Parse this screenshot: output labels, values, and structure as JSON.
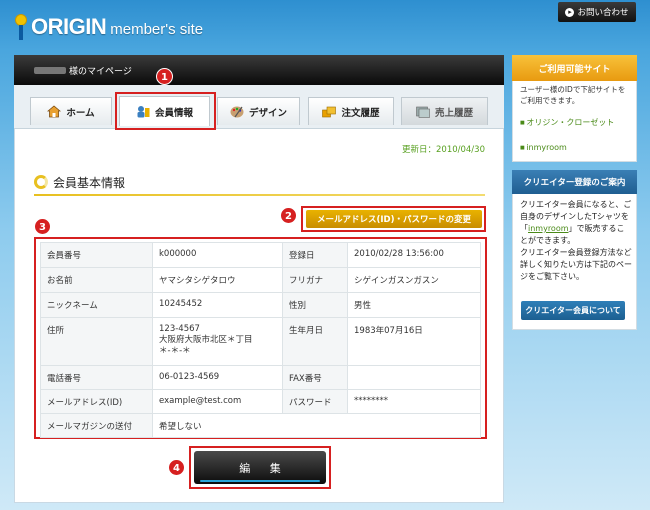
{
  "header": {
    "brand": "ORIGIN",
    "subtitle": "member's site",
    "contact_label": "お問い合わせ"
  },
  "mypage_title": "様のマイページ",
  "tabs": [
    {
      "label": "ホーム",
      "icon": "home-icon"
    },
    {
      "label": "会員情報",
      "icon": "member-icon"
    },
    {
      "label": "デザイン",
      "icon": "palette-icon"
    },
    {
      "label": "注文履歴",
      "icon": "order-history-icon"
    },
    {
      "label": "売上履歴",
      "icon": "sales-history-icon"
    }
  ],
  "updated": "更新日：2010/04/30",
  "section_title": "会員基本情報",
  "mail_password_button": "メールアドレス(ID)・パスワードの変更",
  "badges": [
    "1",
    "2",
    "3",
    "4"
  ],
  "info": {
    "member_no_label": "会員番号",
    "member_no": "k000000",
    "registered_label": "登録日",
    "registered": "2010/02/28 13:56:00",
    "name_label": "お名前",
    "name": "ヤマシタシゲタロウ",
    "furigana_label": "フリガナ",
    "furigana": "シゲインガスンガスン",
    "nickname_label": "ニックネーム",
    "nickname": "10245452",
    "gender_label": "性別",
    "gender": "男性",
    "address_label": "住所",
    "address_zip": "123-4567",
    "address_line1": "大阪府大阪市北区＊丁目",
    "address_line2": "＊-＊-＊",
    "birthday_label": "生年月日",
    "birthday": "1983年07月16日",
    "phone_label": "電話番号",
    "phone": "06-0123-4569",
    "fax_label": "FAX番号",
    "fax": "",
    "email_label": "メールアドレス(ID)",
    "email": "example@test.com",
    "password_label": "パスワード",
    "password": "********",
    "magazine_label": "メールマガジンの送付",
    "magazine": "希望しない"
  },
  "edit_button": "編 集",
  "sidebar": {
    "sites_heading": "ご利用可能サイト",
    "sites_desc": "ユーザー様のIDで下記サイトをご利用できます。",
    "sites": [
      "オリジン・クローゼット",
      "inmyroom"
    ],
    "creator_heading": "クリエイター登録のご案内",
    "creator_text1": "クリエイター会員になると、ご自身のデザインしたTシャツを「",
    "creator_link": "inmyroom",
    "creator_text2": "」で販売することができます。",
    "creator_text3": "クリエイター会員登録方法など詳しく知りたい方は下記のページをご覧下さい。",
    "creator_button": "クリエイター会員について"
  },
  "colors": {
    "accent_red": "#d62020",
    "gold": "#e8b000",
    "link_green": "#4a8a18",
    "update_green": "#58a020"
  }
}
